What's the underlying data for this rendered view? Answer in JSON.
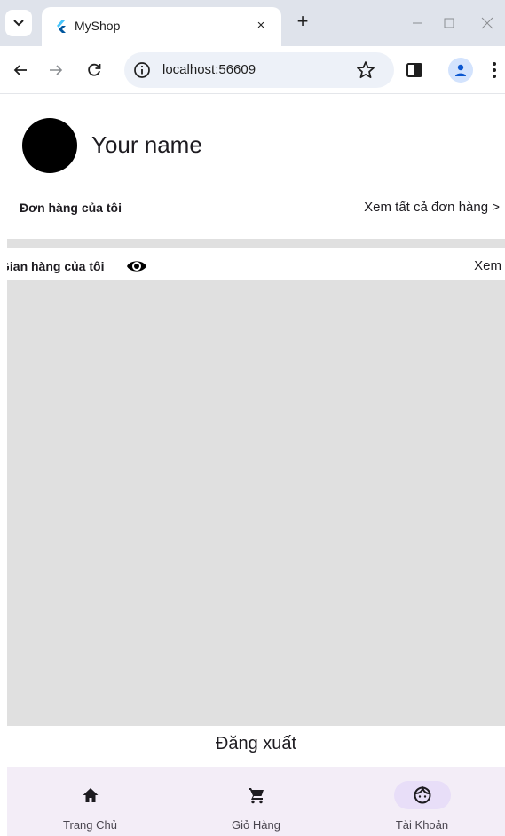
{
  "browser": {
    "tab_title": "MyShop",
    "tab_close_glyph": "×",
    "new_tab_glyph": "+",
    "url": "localhost:56609",
    "icons": [
      "tab-search-icon",
      "flutter-icon",
      "close-icon",
      "plus-icon",
      "minimize-icon",
      "maximize-icon",
      "window-close-icon",
      "back-arrow-icon",
      "forward-arrow-icon",
      "reload-icon",
      "info-icon",
      "star-icon",
      "side-panel-icon",
      "profile-icon",
      "kebab-menu-icon"
    ]
  },
  "profile": {
    "name": "Your name"
  },
  "orders": {
    "title": "Đơn hàng của tôi",
    "view_all": "Xem tất cả đơn hàng >"
  },
  "store": {
    "title": "Gian hàng của tôi",
    "view": "Xem",
    "icon": "eye-icon"
  },
  "logout_label": "Đăng xuất",
  "bottom_nav": {
    "items": [
      {
        "label": "Trang Chủ",
        "icon": "home-icon",
        "active": false
      },
      {
        "label": "Giỏ Hàng",
        "icon": "shopping-cart-icon",
        "active": false
      },
      {
        "label": "Tài Khoản",
        "icon": "account-face-icon",
        "active": true
      }
    ]
  },
  "colors": {
    "tabstrip": "#dfe3eb",
    "omnibox": "#edf1f8",
    "divider": "#e0e0e0",
    "nav_bg": "#f3edf7",
    "nav_active": "#e8def8",
    "text": "#1d1b20"
  }
}
